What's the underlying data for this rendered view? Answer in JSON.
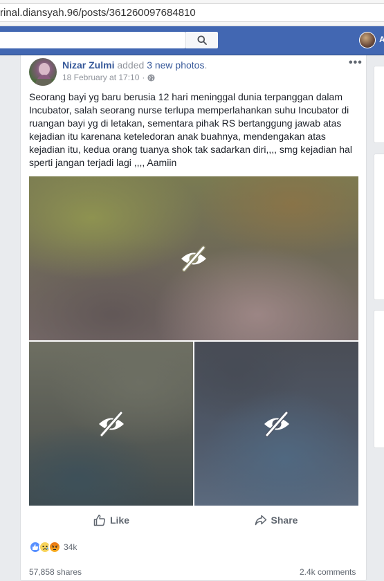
{
  "browser": {
    "url": "rinal.diansyah.96/posts/361260097684810"
  },
  "fb_header": {
    "search_placeholder": "",
    "user_name_fragment": "A"
  },
  "post": {
    "author": "Nizar Zulmi",
    "action_text": " added ",
    "photos_link": "3 new photos",
    "action_suffix": ".",
    "timestamp": "18 February at 17:10",
    "audience_dot": "·",
    "more_label": "•••",
    "text": "Seorang bayi yg baru berusia 12 hari meninggal dunia terpanggan dalam Incubator, salah seorang nurse terlupa memperlahankan suhu Incubator di ruangan bayi yg di letakan, sementara pihak RS bertanggung jawab atas kejadian itu karenana keteledoran anak buahnya, mendengakan atas kejadian itu, kedua orang tuanya shok tak sadarkan diri,,,, smg kejadian hal sperti jangan terjadi lagi ,,,, Aamiin",
    "photos": [
      {
        "state": "hidden",
        "icon": "eye-slash-icon"
      },
      {
        "state": "hidden",
        "icon": "eye-slash-icon"
      },
      {
        "state": "hidden",
        "icon": "eye-slash-icon"
      }
    ],
    "actions": {
      "like": "Like",
      "share": "Share"
    },
    "reactions": {
      "types": [
        "like",
        "sad",
        "angry"
      ],
      "count": "34k"
    },
    "shares": "57,858 shares",
    "comments": "2.4k comments"
  },
  "colors": {
    "fb_blue": "#4267b2",
    "link": "#365899",
    "meta": "#90949c"
  }
}
